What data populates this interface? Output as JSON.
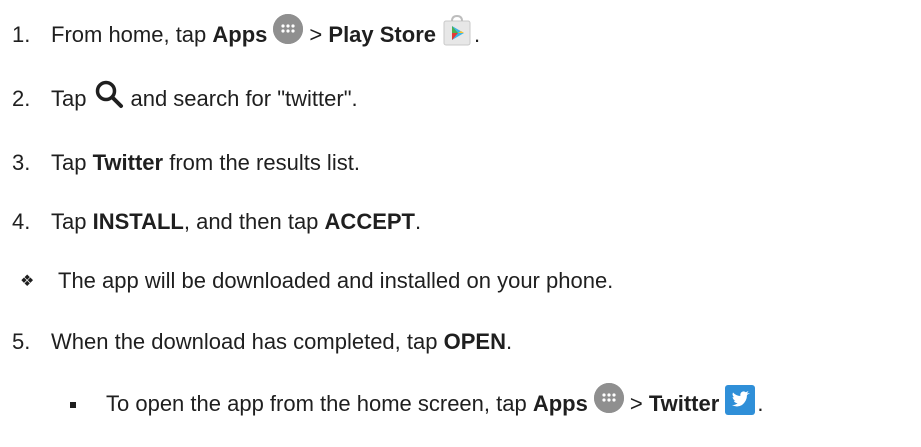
{
  "steps": [
    {
      "number": "1.",
      "text_before": "From home, tap",
      "apps": "Apps",
      "sep": ">",
      "store": "Play Store",
      "end": "."
    },
    {
      "number": "2.",
      "text_before": "Tap",
      "text_after": "and search for \"twitter\"."
    },
    {
      "number": "3.",
      "text_before": "Tap",
      "bold": "Twitter",
      "text_after": "from the results list."
    },
    {
      "number": "4.",
      "text_before": "Tap",
      "bold1": "INSTALL",
      "text_mid": ", and then tap",
      "bold2": "ACCEPT",
      "end": "."
    },
    {
      "bullet_symbol": "❖",
      "text": "The app will be downloaded and installed on your phone."
    },
    {
      "number": "5.",
      "text_before": "When the download has completed, tap",
      "bold": "OPEN",
      "end": "."
    },
    {
      "text_before": "To open the app from the home screen, tap",
      "apps": "Apps",
      "sep": ">",
      "twitter": "Twitter",
      "end": "."
    }
  ],
  "icons": {
    "apps": "apps-grid-icon",
    "play_store": "play-store-icon",
    "search": "search-icon",
    "twitter": "twitter-icon"
  }
}
